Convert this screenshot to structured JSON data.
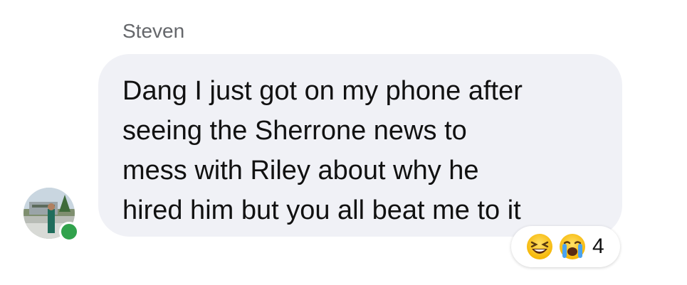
{
  "message": {
    "sender": "Steven",
    "text": "Dang I just got on my phone after\nseeing the Sherrone news to\nmess with Riley about why he\nhired him but you all beat me to it"
  },
  "reactions": {
    "icons": [
      "laughing-emoji-icon",
      "crying-emoji-icon"
    ],
    "count": "4"
  },
  "colors": {
    "bubble": "#f0f1f6",
    "online": "#31a24c",
    "sender": "#65676b"
  }
}
